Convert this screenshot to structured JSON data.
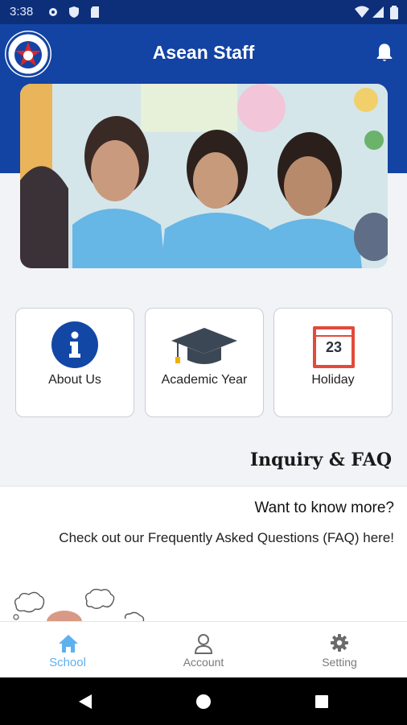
{
  "status_bar": {
    "time": "3:38"
  },
  "header": {
    "title": "Asean Staff"
  },
  "cards": [
    {
      "label": "About Us",
      "icon": "info-icon"
    },
    {
      "label": "Academic Year",
      "icon": "graduation-cap-icon"
    },
    {
      "label": "Holiday",
      "icon": "calendar-icon",
      "calendar_day": "23"
    }
  ],
  "faq": {
    "section_title": "Inquiry & FAQ",
    "heading": "Want to know more?",
    "text": "Check out our Frequently Asked Questions (FAQ) here!"
  },
  "bottom_nav": [
    {
      "label": "School",
      "icon": "home-icon",
      "active": true
    },
    {
      "label": "Account",
      "icon": "user-icon",
      "active": false
    },
    {
      "label": "Setting",
      "icon": "gear-icon",
      "active": false
    }
  ],
  "colors": {
    "status_bar": "#0d2f7a",
    "header": "#1343a3",
    "active_tab": "#5fb0ee",
    "inactive_tab": "#7a7a7a",
    "holiday_red": "#e24a3b"
  }
}
